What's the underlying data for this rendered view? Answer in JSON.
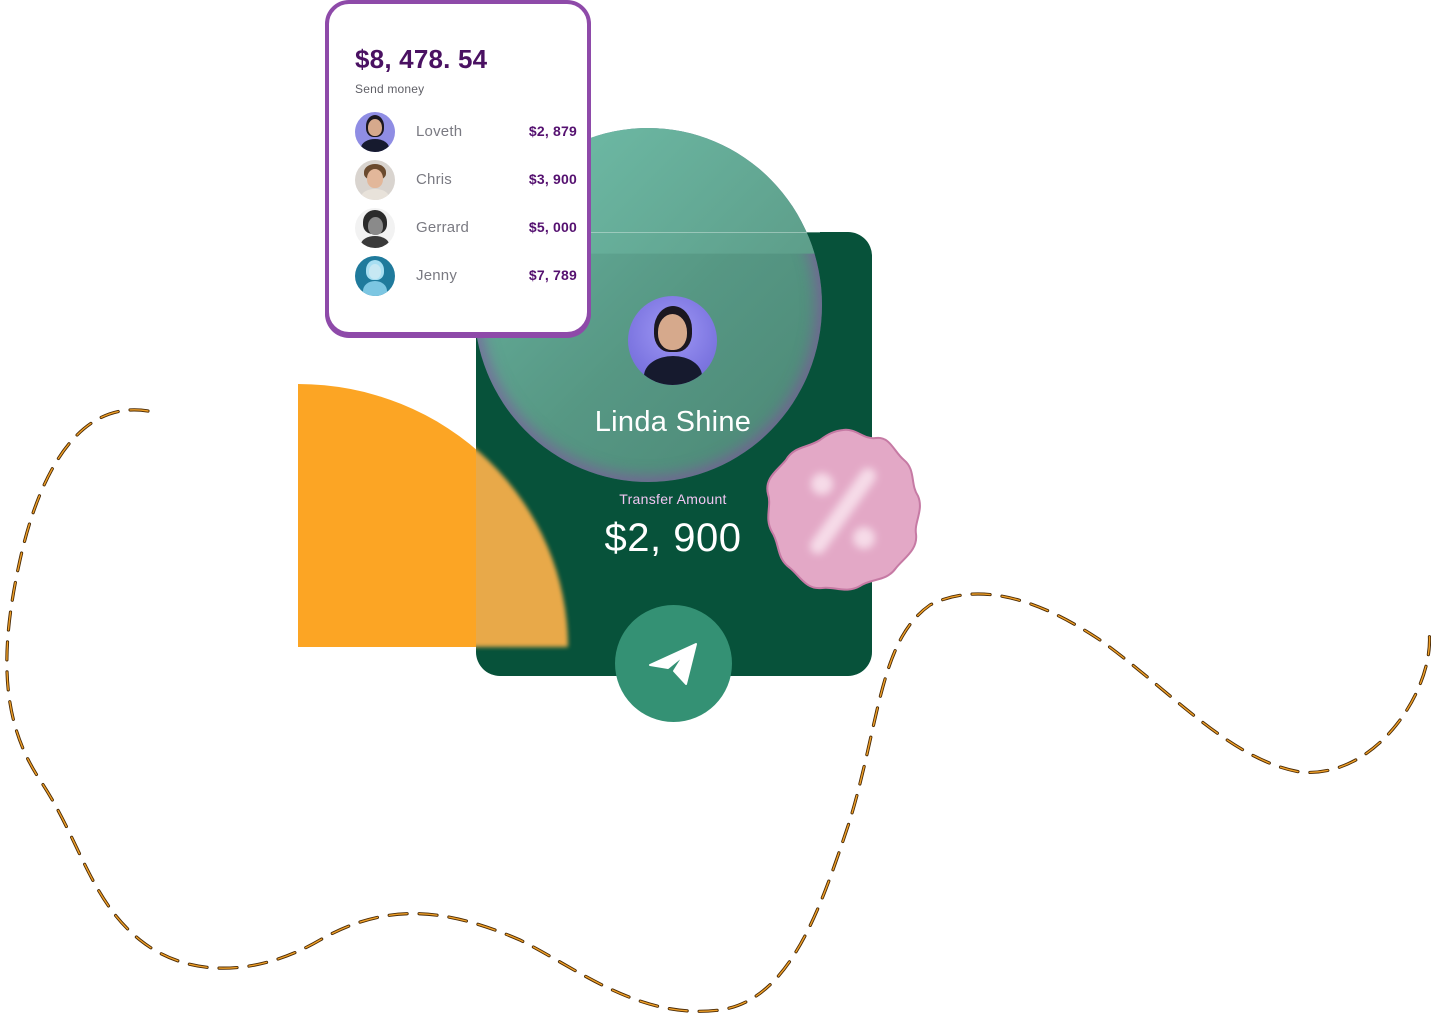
{
  "panel": {
    "total": "$8, 478. 54",
    "subtitle": "Send money",
    "recipients": [
      {
        "name": "Loveth",
        "amount": "$2, 879",
        "avatar_icon": "user-avatar-icon"
      },
      {
        "name": "Chris",
        "amount": "$3, 900",
        "avatar_icon": "user-avatar-icon"
      },
      {
        "name": "Gerrard",
        "amount": "$5, 000",
        "avatar_icon": "user-avatar-icon"
      },
      {
        "name": "Jenny",
        "amount": "$7, 789",
        "avatar_icon": "user-avatar-icon"
      }
    ]
  },
  "card": {
    "name": "Linda Shine",
    "transfer_label": "Transfer Amount",
    "transfer_amount": "$2, 900",
    "send_icon": "paper-plane-icon",
    "discount_icon": "percent-icon"
  },
  "colors": {
    "card_green": "#07523a",
    "button_green": "#349174",
    "accent_purple": "#8e4aa9",
    "amount_purple": "#551170",
    "orange": "#fca524",
    "pink": "#e5a9c8",
    "dash_line": "#b07a1f"
  }
}
